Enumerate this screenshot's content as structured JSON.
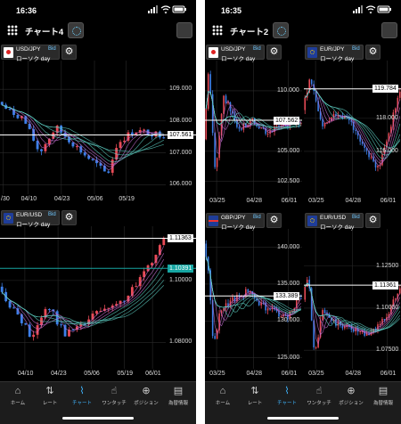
{
  "left": {
    "status": {
      "time": "16:36"
    },
    "title": "チャート4",
    "panels": [
      {
        "id": "usdjpy",
        "pair": "USD/JPY",
        "bid": "Bid",
        "chart_type": "ローソク day",
        "prices": [
          "109.000",
          "108.000",
          "107.000",
          "106.000"
        ],
        "price_values": [
          109,
          108,
          107,
          106
        ],
        "current": "107.561",
        "current_value": 107.561,
        "ymax": 109.9,
        "ymin": 105.7,
        "dates": [
          "/30",
          "04/10",
          "04/23",
          "05/06",
          "05/19"
        ],
        "date_pos": [
          0.02,
          0.17,
          0.37,
          0.57,
          0.76
        ],
        "start": 107.3,
        "end": 107.56,
        "trend": "sideways",
        "seed": 7,
        "shape": [
          [
            0,
            108.6
          ],
          [
            0.07,
            108.3
          ],
          [
            0.15,
            108.1
          ],
          [
            0.25,
            107.0
          ],
          [
            0.35,
            107.8
          ],
          [
            0.45,
            107.3
          ],
          [
            0.53,
            106.9
          ],
          [
            0.6,
            106.6
          ],
          [
            0.66,
            106.3
          ],
          [
            0.72,
            107.3
          ],
          [
            0.82,
            107.7
          ],
          [
            1,
            107.56
          ]
        ]
      },
      {
        "id": "eurusd",
        "pair": "EUR/USD",
        "bid": "Bid",
        "chart_type": "ローソク day",
        "prices": [
          "1.10000",
          "1.08000"
        ],
        "price_values": [
          1.1,
          1.08
        ],
        "current": "1.11363",
        "current_value": 1.11363,
        "tag2": "1.10391",
        "tag2_value": 1.10391,
        "ymax": 1.1175,
        "ymin": 1.0715,
        "dates": [
          "04/10",
          "04/23",
          "05/06",
          "05/19",
          "06/01"
        ],
        "date_pos": [
          0.15,
          0.35,
          0.55,
          0.75,
          0.92
        ],
        "seed": 13,
        "shape": [
          [
            0,
            1.098
          ],
          [
            0.1,
            1.09
          ],
          [
            0.2,
            1.082
          ],
          [
            0.3,
            1.092
          ],
          [
            0.4,
            1.083
          ],
          [
            0.5,
            1.085
          ],
          [
            0.6,
            1.09
          ],
          [
            0.7,
            1.091
          ],
          [
            0.8,
            1.096
          ],
          [
            0.9,
            1.104
          ],
          [
            1,
            1.1136
          ]
        ]
      }
    ],
    "tabs": [
      "ホーム",
      "レート",
      "チャート",
      "ワンタッチ",
      "ポジション",
      "為替情報"
    ]
  },
  "right": {
    "status": {
      "time": "16:35"
    },
    "title": "チャート2",
    "panels": [
      {
        "id": "usdjpy",
        "pair": "USD/JPY",
        "bid": "Bid",
        "chart_type": "ローソク day",
        "prices": [
          "110.000",
          "105.000",
          "102.500"
        ],
        "price_values": [
          110,
          105,
          102.5
        ],
        "current": "107.562",
        "current_value": 107.562,
        "ymax": 112.5,
        "ymin": 101.3,
        "dates": [
          "03/25",
          "04/28",
          "06/01"
        ],
        "date_pos": [
          0.12,
          0.5,
          0.86
        ],
        "seed": 21,
        "shape": [
          [
            0,
            106
          ],
          [
            0.05,
            111.8
          ],
          [
            0.12,
            102.8
          ],
          [
            0.2,
            109.8
          ],
          [
            0.35,
            106.8
          ],
          [
            0.5,
            107.5
          ],
          [
            0.65,
            106.5
          ],
          [
            0.8,
            107.2
          ],
          [
            1,
            107.56
          ]
        ]
      },
      {
        "id": "eurjpy",
        "pair": "EUR/JPY",
        "bid": "Bid",
        "chart_type": "ローソク day",
        "prices": [
          "118.000",
          "116.000"
        ],
        "price_values": [
          118,
          116
        ],
        "current": "119.784",
        "current_value": 119.784,
        "ymax": 121.5,
        "ymin": 113.3,
        "dates": [
          "03/25",
          "04/28",
          "06/01"
        ],
        "date_pos": [
          0.12,
          0.5,
          0.86
        ],
        "seed": 29,
        "shape": [
          [
            0,
            118.5
          ],
          [
            0.08,
            120.5
          ],
          [
            0.2,
            117.5
          ],
          [
            0.35,
            118.4
          ],
          [
            0.5,
            117.8
          ],
          [
            0.6,
            116.4
          ],
          [
            0.7,
            115.6
          ],
          [
            0.78,
            114.9
          ],
          [
            0.88,
            117
          ],
          [
            1,
            119.78
          ]
        ]
      },
      {
        "id": "gbpjpy",
        "pair": "GBP/JPY",
        "bid": "Bid",
        "chart_type": "ローソク day",
        "prices": [
          "140.000",
          "135.000",
          "130.000",
          "125.000"
        ],
        "price_values": [
          140,
          135,
          130,
          125
        ],
        "current": "133.389",
        "current_value": 133.389,
        "ymax": 142.5,
        "ymin": 123.5,
        "dates": [
          "03/25",
          "04/28",
          "06/01"
        ],
        "date_pos": [
          0.12,
          0.5,
          0.86
        ],
        "seed": 33,
        "shape": [
          [
            0,
            140.5
          ],
          [
            0.05,
            137
          ],
          [
            0.1,
            126
          ],
          [
            0.16,
            131
          ],
          [
            0.3,
            133
          ],
          [
            0.45,
            134
          ],
          [
            0.6,
            132.2
          ],
          [
            0.72,
            131.2
          ],
          [
            0.85,
            130.4
          ],
          [
            1,
            133.4
          ]
        ]
      },
      {
        "id": "eurusd",
        "pair": "EUR/USD",
        "bid": "Bid",
        "chart_type": "ローソク day",
        "prices": [
          "1.12500",
          "1.10000",
          "1.07500"
        ],
        "price_values": [
          1.125,
          1.1,
          1.075
        ],
        "current": "1.11361",
        "current_value": 1.11361,
        "ymax": 1.147,
        "ymin": 1.064,
        "dates": [
          "03/25",
          "04/28",
          "06/01"
        ],
        "date_pos": [
          0.12,
          0.5,
          0.86
        ],
        "seed": 41,
        "shape": [
          [
            0,
            1.105
          ],
          [
            0.06,
            1.12
          ],
          [
            0.12,
            1.07
          ],
          [
            0.2,
            1.098
          ],
          [
            0.35,
            1.09
          ],
          [
            0.5,
            1.088
          ],
          [
            0.65,
            1.083
          ],
          [
            0.78,
            1.09
          ],
          [
            0.88,
            1.096
          ],
          [
            1,
            1.1136
          ]
        ]
      }
    ],
    "tabs": [
      "ホーム",
      "レート",
      "チャート",
      "ワンタッチ",
      "ポジション",
      "為替情報"
    ]
  },
  "colors": {
    "up": "#e94b57",
    "down": "#3d7fe8",
    "accent": "#3fb6ff",
    "ma": "#5fd3c7"
  },
  "icons": [
    "grid-menu-icon",
    "settings-gear-icon",
    "layout-flip-icon",
    "home-icon",
    "rate-icon",
    "chart-icon",
    "one-touch-icon",
    "position-icon",
    "fx-info-icon"
  ]
}
